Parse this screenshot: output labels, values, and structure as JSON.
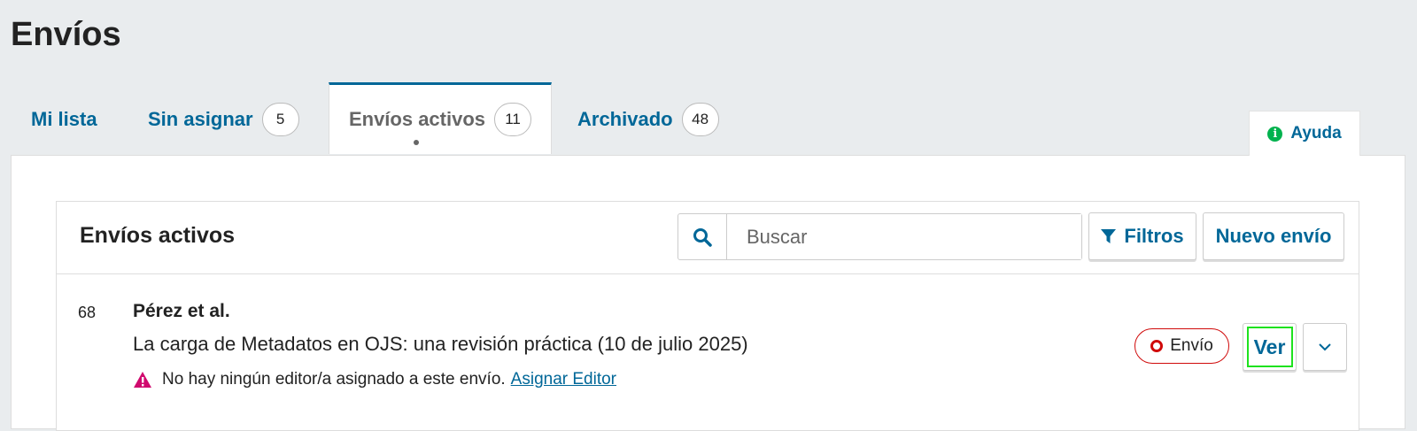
{
  "page": {
    "title": "Envíos"
  },
  "tabs": [
    {
      "label": "Mi lista",
      "count": null
    },
    {
      "label": "Sin asignar",
      "count": "5"
    },
    {
      "label": "Envíos activos",
      "count": "11",
      "active": true
    },
    {
      "label": "Archivado",
      "count": "48"
    }
  ],
  "help": {
    "label": "Ayuda",
    "icon": "info-icon"
  },
  "list": {
    "title": "Envíos activos",
    "search_placeholder": "Buscar",
    "filter_label": "Filtros",
    "new_label": "Nuevo envío"
  },
  "submissions": [
    {
      "id": "68",
      "author": "Pérez et al.",
      "title": "La carga de Metadatos en OJS: una revisión práctica (10 de julio 2025)",
      "warning_text": "No hay ningún editor/a asignado a este envío.",
      "warning_link": "Asignar Editor",
      "stage": "Envío",
      "view_label": "Ver"
    }
  ],
  "colors": {
    "link": "#006798",
    "stage": "#d00a0a",
    "warning": "#d00a6e",
    "help_icon": "#00b24e",
    "focus": "#1ee21e"
  }
}
